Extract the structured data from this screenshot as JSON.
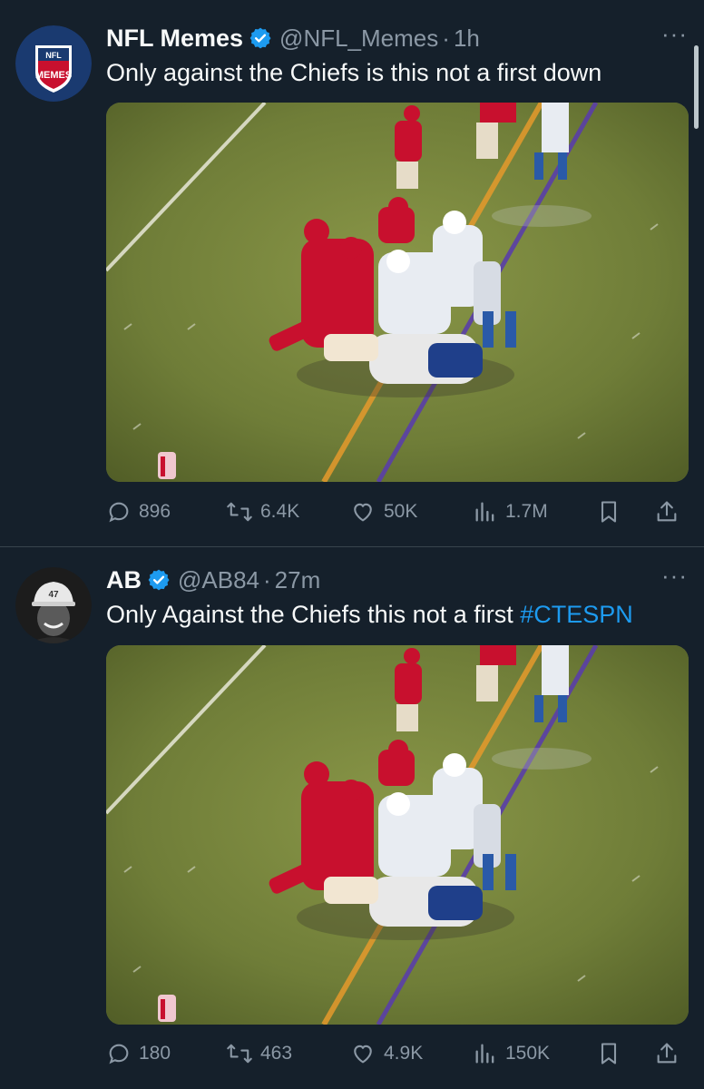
{
  "tweets": [
    {
      "name": "NFL Memes",
      "handle": "@NFL_Memes",
      "time": "1h",
      "text": "Only against the Chiefs is this not a first down",
      "hashtag": "",
      "avatar_logo_top": "NFL",
      "avatar_logo_bottom": "MEMES",
      "replies": "896",
      "retweets": "6.4K",
      "likes": "50K",
      "views": "1.7M"
    },
    {
      "name": "AB",
      "handle": "@AB84",
      "time": "27m",
      "text": "Only Against the Chiefs this not a first ",
      "hashtag": "#CTESPN",
      "avatar_cap_number": "47",
      "replies": "180",
      "retweets": "463",
      "likes": "4.9K",
      "views": "150K"
    }
  ],
  "ui": {
    "more": "···",
    "separator": "·"
  },
  "colors": {
    "background": "#15202b",
    "verified": "#1d9bf0",
    "muted": "#8b98a5",
    "hashtag": "#1d9bf0"
  },
  "icons": [
    "reply-icon",
    "retweet-icon",
    "like-icon",
    "views-icon",
    "bookmark-icon",
    "share-icon",
    "verified-badge-icon",
    "more-icon"
  ]
}
